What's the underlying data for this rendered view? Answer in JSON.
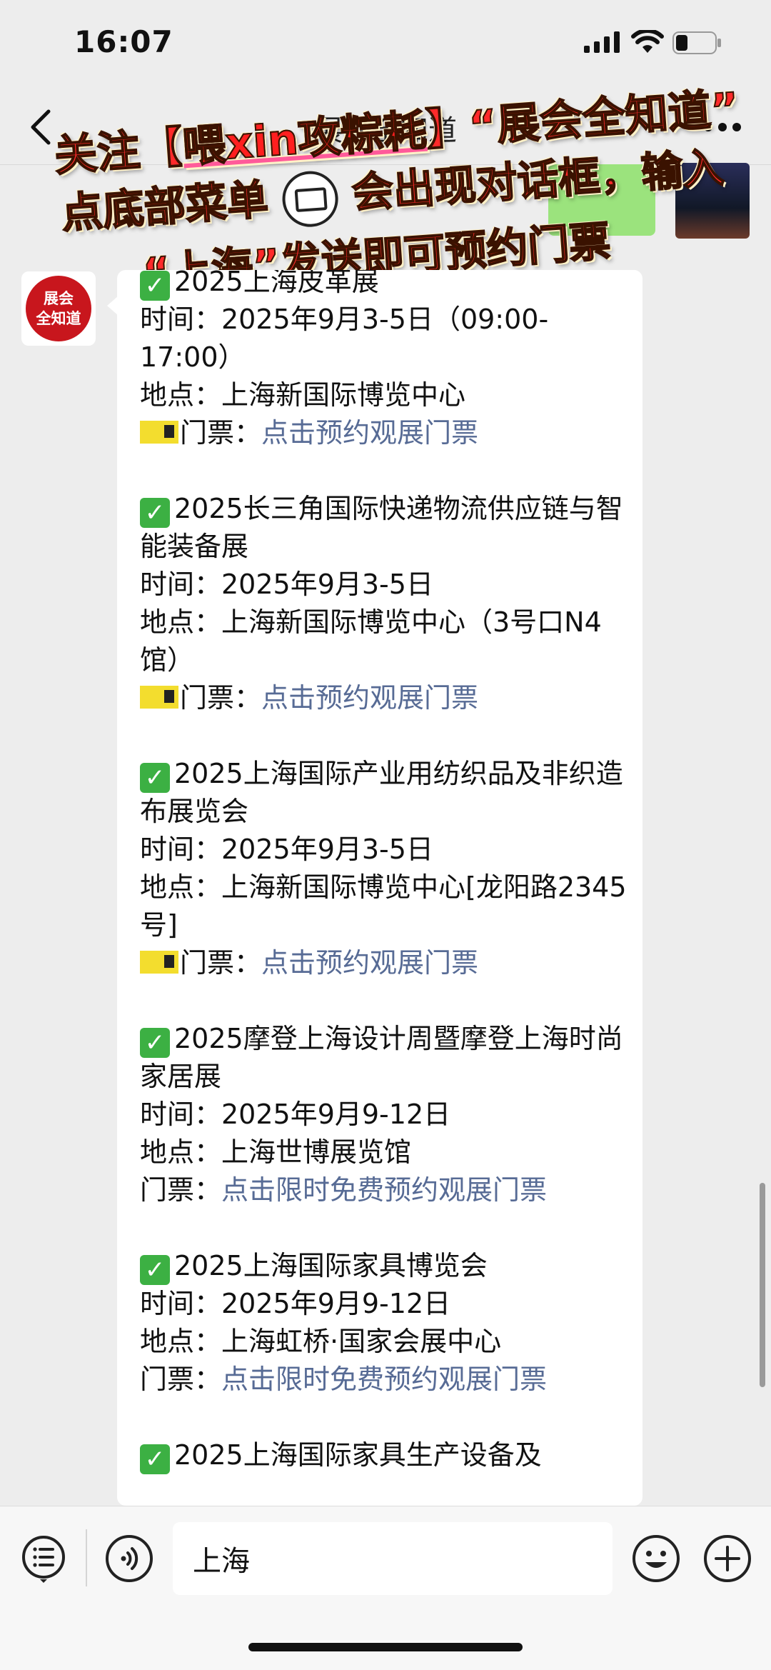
{
  "status": {
    "time": "16:07"
  },
  "nav": {
    "title": "展会全知道"
  },
  "promo": {
    "line1_prefix": "关注【",
    "line1_highlight": "喂xin攻粽耗",
    "line1_suffix": "】“展会全知道”",
    "line2_a": "点底部菜单",
    "line2_b": "会出现对话框，输入",
    "line3_a": "“",
    "line3_highlight": "上海",
    "line3_b": "”发送即可预约门票"
  },
  "avatar": {
    "line1": "展会",
    "line2": "全知道"
  },
  "messages": [
    {
      "title": "2025上海皮革展",
      "time": "时间：2025年9月3-5日（09:00-17:00）",
      "place": "地点：上海新国际博览中心",
      "ticket_label": "门票：",
      "ticket_link": "点击预约观展门票",
      "has_ticket_icon": true
    },
    {
      "title": "2025长三角国际快递物流供应链与智能装备展",
      "time": "时间：2025年9月3-5日",
      "place": "地点：上海新国际博览中心（3号口N4馆）",
      "ticket_label": "门票：",
      "ticket_link": "点击预约观展门票",
      "has_ticket_icon": true
    },
    {
      "title": "2025上海国际产业用纺织品及非织造布展览会",
      "time": "时间：2025年9月3-5日",
      "place": "地点：上海新国际博览中心[龙阳路2345号]",
      "ticket_label": "门票：",
      "ticket_link": "点击预约观展门票",
      "has_ticket_icon": true
    },
    {
      "title": "2025摩登上海设计周暨摩登上海时尚家居展",
      "time": "时间：2025年9月9-12日",
      "place": "地点：上海世博展览馆",
      "ticket_label": "门票：",
      "ticket_link": "点击限时免费预约观展门票",
      "has_ticket_icon": false
    },
    {
      "title": "2025上海国际家具博览会",
      "time": "时间：2025年9月9-12日",
      "place": "地点：上海虹桥·国家会展中心",
      "ticket_label": "门票：",
      "ticket_link": "点击限时免费预约观展门票",
      "has_ticket_icon": false
    },
    {
      "title": "2025上海国际家具生产设备及",
      "time": "",
      "place": "",
      "ticket_label": "",
      "ticket_link": "",
      "has_ticket_icon": false
    }
  ],
  "input": {
    "value": "上海"
  },
  "colors": {
    "link": "#576b95",
    "check": "#3cb043",
    "avatar": "#c8161d"
  }
}
